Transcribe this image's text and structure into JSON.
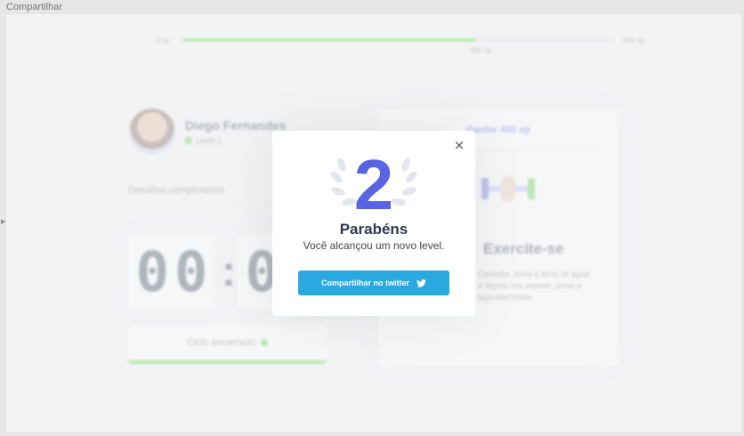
{
  "window": {
    "title": "Compartilhar"
  },
  "experience": {
    "start": "0 xp",
    "current": "400 xp",
    "end": "600 xp",
    "progress_percent": 68
  },
  "profile": {
    "name": "Diego Fernandes",
    "level": "Level 1"
  },
  "challenges": {
    "label": "Desafios completados"
  },
  "countdown": {
    "minute_1": "0",
    "minute_2": "0",
    "separator": ":",
    "second_1": "0",
    "second_2": "0"
  },
  "cycle": {
    "label": "Ciclo encerrado"
  },
  "challenge_card": {
    "gain": "Ganhe 400 xp",
    "title": "Exercite-se",
    "description": "Caminhe, tome 6 litros de água e depois uns passos, pulos e faça exercícios."
  },
  "modal": {
    "level": "2",
    "title": "Parabéns",
    "subtitle": "Você alcançou um novo level.",
    "share_label": "Compartilhar no twitter",
    "close_icon": "×"
  },
  "colors": {
    "accent": "#5965e0",
    "green": "#4cd62b",
    "twitter": "#2aa9e0",
    "text": "#2e384d"
  }
}
